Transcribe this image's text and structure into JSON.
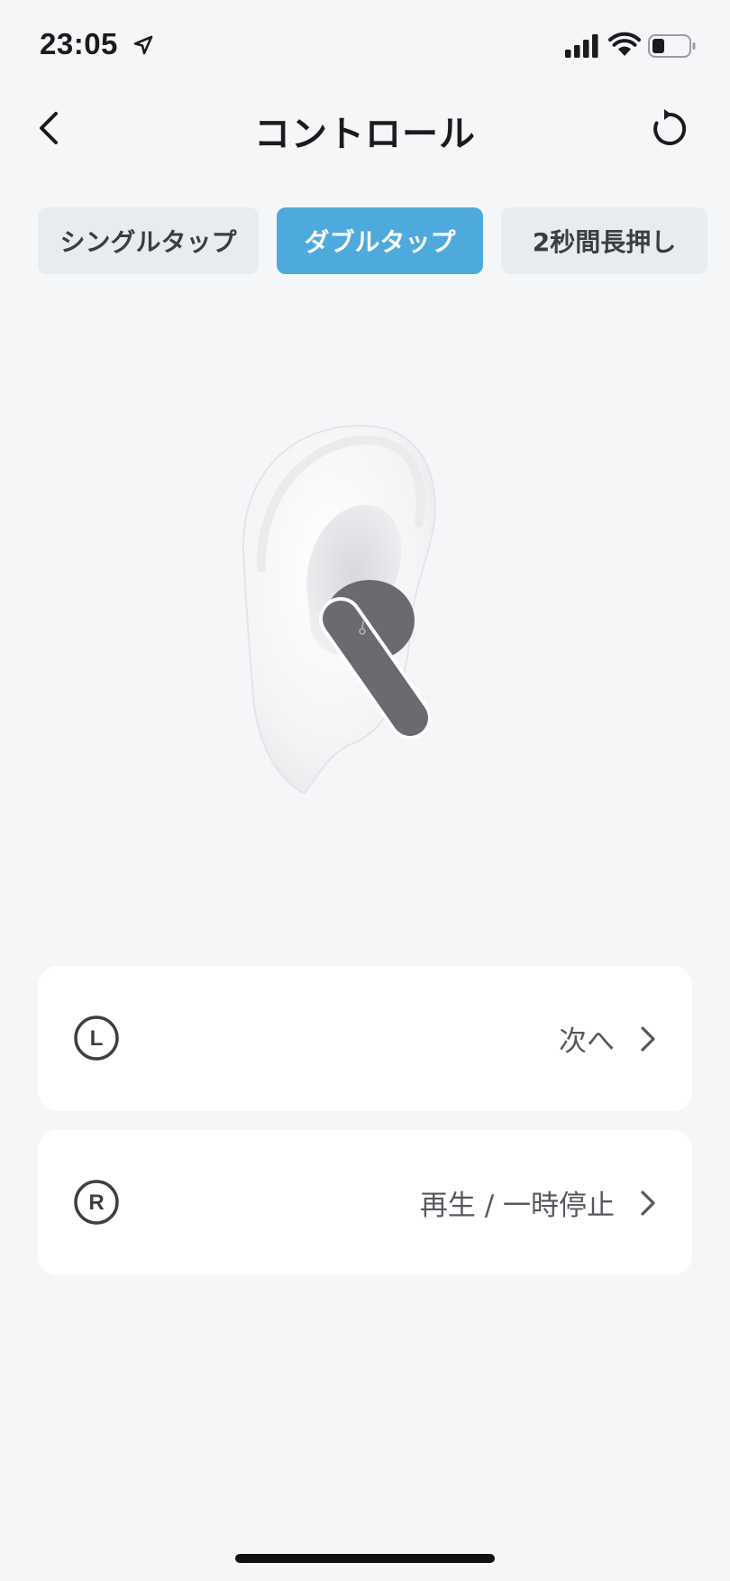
{
  "status_bar": {
    "time": "23:05"
  },
  "nav": {
    "title": "コントロール"
  },
  "tabs": [
    {
      "label": "シングルタップ",
      "active": false
    },
    {
      "label": "ダブルタップ",
      "active": true
    },
    {
      "label": "2秒間長押し",
      "active": false
    }
  ],
  "controls": {
    "left": {
      "badge": "L",
      "action": "次へ"
    },
    "right": {
      "badge": "R",
      "action": "再生 / 一時停止"
    }
  },
  "colors": {
    "accent": "#4ea9dd",
    "background": "#f4f6f8",
    "card": "#ffffff",
    "earbud": "#6a6b70"
  },
  "icons": {
    "back": "chevron-left-icon",
    "reset": "reset-icon",
    "location": "location-arrow-icon",
    "signal": "cellular-signal-icon",
    "wifi": "wifi-icon",
    "battery": "battery-icon",
    "row_chevron": "chevron-right-icon"
  }
}
